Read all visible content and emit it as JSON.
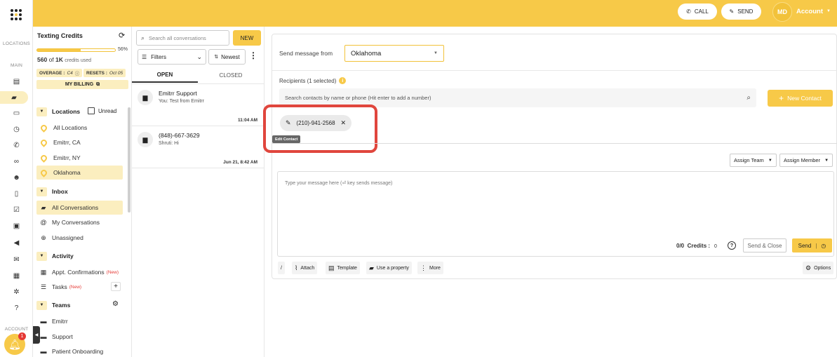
{
  "header": {
    "call_label": "CALL",
    "send_label": "SEND",
    "avatar_initials": "MD",
    "account_label": "Account"
  },
  "rail": {
    "locations_label": "LOCATIONS",
    "main_label": "MAIN",
    "account_label": "ACCOUNT",
    "notification_count": "1"
  },
  "sidebar": {
    "credits_title": "Texting Credits",
    "credits_percent_text": "56%",
    "credits_fraction": 0.56,
    "credits_used_num": "560",
    "credits_of": "of",
    "credits_total": "1K",
    "credits_used_suffix": "credits used",
    "overage_label": "OVERAGE :",
    "overage_value": "C4",
    "resets_label": "RESETS :",
    "resets_value": "Oct 05",
    "billing_label": "MY BILLING",
    "locations_title": "Locations",
    "unread_label": "Unread",
    "locations": [
      {
        "label": "All Locations"
      },
      {
        "label": "Emitrr, CA"
      },
      {
        "label": "Emitrr, NY"
      },
      {
        "label": "Oklahoma"
      }
    ],
    "inbox_title": "Inbox",
    "inbox": [
      {
        "label": "All Conversations"
      },
      {
        "label": "My Conversations"
      },
      {
        "label": "Unassigned"
      }
    ],
    "activity_title": "Activity",
    "activity": [
      {
        "label": "Appt. Confirmations",
        "tag": "(New)"
      },
      {
        "label": "Tasks",
        "tag": "(New)"
      }
    ],
    "teams_title": "Teams",
    "teams": [
      {
        "label": "Emitrr"
      },
      {
        "label": "Support"
      },
      {
        "label": "Patient Onboarding"
      }
    ]
  },
  "conversations": {
    "search_placeholder": "Search all conversations",
    "new_label": "NEW",
    "filters_label": "Filters",
    "sort_label": "Newest",
    "tab_open": "OPEN",
    "tab_closed": "CLOSED",
    "items": [
      {
        "name": "Emitrr Support",
        "preview": "You: Test from Emitrr",
        "time": "11:04 AM"
      },
      {
        "name": "(848)-667-3629",
        "preview": "Shruti: Hi",
        "time": "Jun 21, 8:42 AM"
      }
    ]
  },
  "compose": {
    "send_from_label": "Send message from",
    "send_from_value": "Oklahoma",
    "recipients_label": "Recipients (1 selected)",
    "recipient_search_placeholder": "Search contacts by name or phone (Hit enter to add a number)",
    "new_contact_label": "New Contact",
    "recipient_chip": "(210)-941-2568",
    "tooltip": "Edit Contact",
    "assign_team_label": "Assign Team",
    "assign_member_label": "Assign Member",
    "message_placeholder": "Type your message here (⏎ key sends message)",
    "count_text": "0/0",
    "credits_label": "Credits :",
    "credits_value": "0",
    "send_close_label": "Send & Close",
    "send_label": "Send",
    "toolbar": {
      "slash": "/",
      "attach": "Attach",
      "template": "Template",
      "property": "Use a property",
      "more": "More",
      "options": "Options"
    }
  }
}
